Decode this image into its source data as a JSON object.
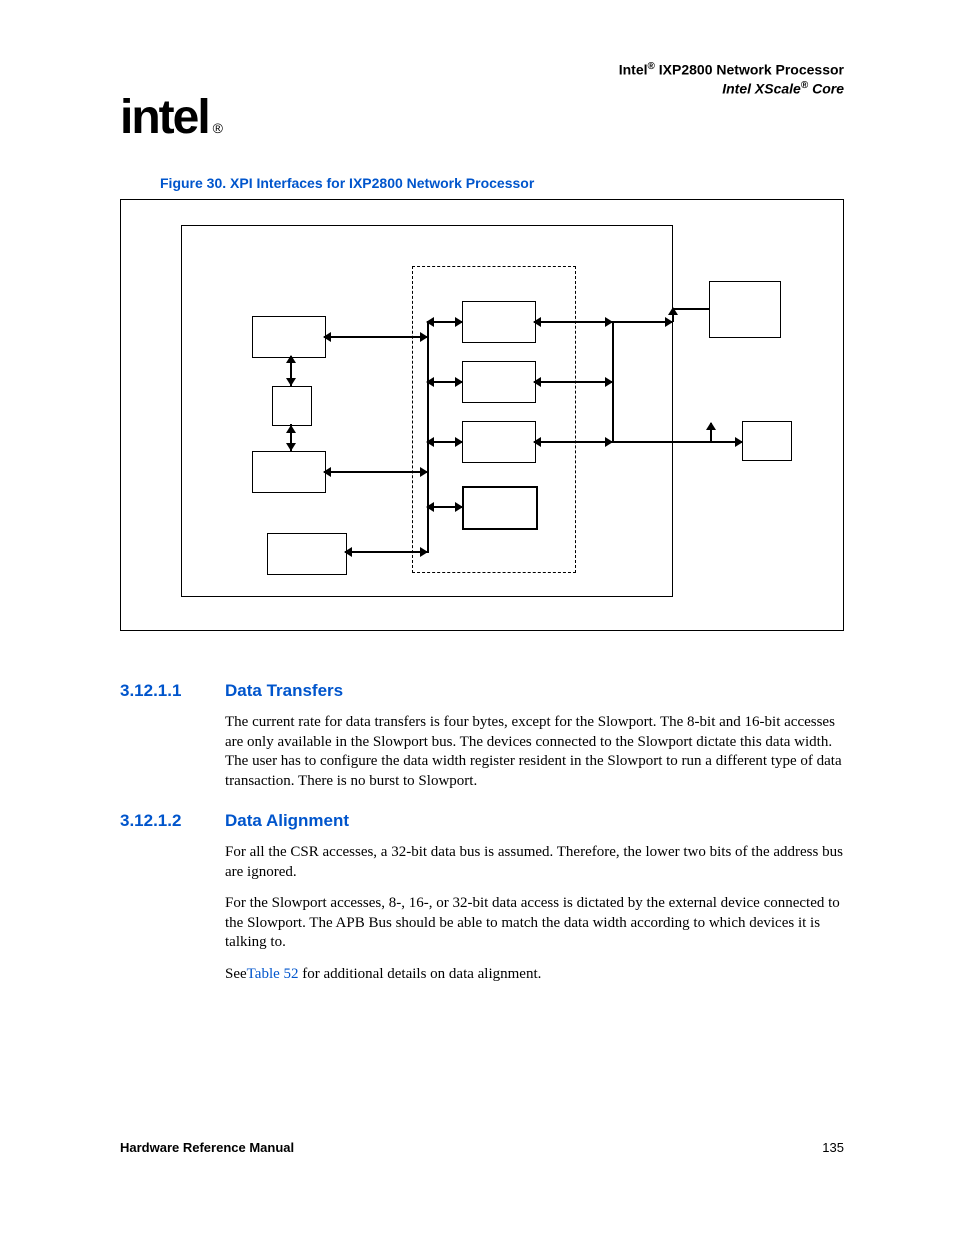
{
  "header": {
    "line1_pre": "Intel",
    "line1_post": " IXP2800 Network Processor",
    "line2_pre": "Intel XScale",
    "line2_post": " Core"
  },
  "logo": {
    "text": "intel",
    "reg": "®"
  },
  "figure": {
    "caption": "Figure 30. XPI Interfaces for IXP2800 Network Processor"
  },
  "sections": [
    {
      "num": "3.12.1.1",
      "title": "Data Transfers",
      "paragraphs": [
        "The current rate for data transfers is four bytes, except for the Slowport. The 8-bit and 16-bit accesses are only available in the Slowport bus. The devices connected to the Slowport dictate this data width. The user has to configure the data width register resident in the Slowport to run a different type of data transaction. There is no burst to Slowport."
      ]
    },
    {
      "num": "3.12.1.2",
      "title": "Data Alignment",
      "paragraphs": [
        "For all the CSR accesses, a 32-bit data bus is assumed. Therefore, the lower two bits of the address bus are ignored.",
        "For the Slowport accesses, 8-, 16-, or 32-bit data access is dictated by the external device connected to the Slowport. The APB Bus should be able to match the data width according to which devices it is talking to."
      ],
      "see_pre": "See",
      "see_link": "Table 52",
      "see_post": " for additional details on data alignment."
    }
  ],
  "footer": {
    "left": "Hardware Reference Manual",
    "right": "135"
  }
}
